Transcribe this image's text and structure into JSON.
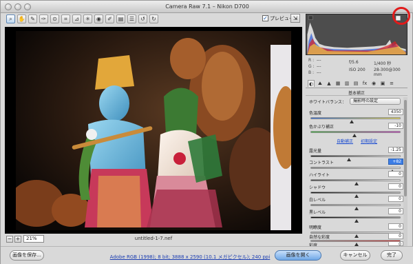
{
  "window": {
    "title": "Camera Raw 7.1  –  Nikon D700"
  },
  "toolbar": {
    "tools": [
      {
        "icon": "zoom-icon",
        "glyph": "⌕"
      },
      {
        "icon": "hand-icon",
        "glyph": "✋"
      },
      {
        "icon": "white-balance-icon",
        "glyph": "✎"
      },
      {
        "icon": "color-sampler-icon",
        "glyph": "✑"
      },
      {
        "icon": "target-adjust-icon",
        "glyph": "⊙"
      },
      {
        "icon": "crop-icon",
        "glyph": "⌗"
      },
      {
        "icon": "straighten-icon",
        "glyph": "⊿"
      },
      {
        "icon": "spot-removal-icon",
        "glyph": "✳"
      },
      {
        "icon": "red-eye-icon",
        "glyph": "◉"
      },
      {
        "icon": "adjustment-brush-icon",
        "glyph": "✐"
      },
      {
        "icon": "graduated-filter-icon",
        "glyph": "▤"
      },
      {
        "icon": "preferences-icon",
        "glyph": "☰"
      },
      {
        "icon": "rotate-ccw-icon",
        "glyph": "↺"
      },
      {
        "icon": "rotate-cw-icon",
        "glyph": "↻"
      }
    ],
    "preview_label": "プレビュー",
    "preview_checked": "✓",
    "fullscreen_glyph": "⇲"
  },
  "status": {
    "zoom_out": "−",
    "zoom_in": "+",
    "zoom": "21%",
    "filename": "untitled-1-7.nef"
  },
  "info": {
    "r": "R :",
    "g": "G :",
    "b": "B :",
    "r_val": "---",
    "g_val": "---",
    "b_val": "---",
    "aperture": "f/5.6",
    "shutter": "1/400 秒",
    "iso": "ISO 200",
    "lens": "28-300@300 mm"
  },
  "panel": {
    "tabs": [
      "◐",
      "⛰",
      "▲",
      "▦",
      "▥",
      "▤",
      "fx",
      "◉",
      "▣",
      "≡"
    ],
    "title": "基本補正",
    "wb_label": "ホワイトバランス：",
    "wb_value": "撮影時の設定",
    "temp_label": "色温度",
    "temp_value": "4350",
    "tint_label": "色かぶり補正",
    "tint_value": "-10",
    "auto_link": "自動補正",
    "default_link": "初期設定",
    "exposure_label": "露光量",
    "exposure_value": "-1.25",
    "contrast_label": "コントラスト",
    "contrast_value": "+82",
    "highlights_label": "ハイライト",
    "highlights_value": "0",
    "shadows_label": "シャドウ",
    "shadows_value": "0",
    "whites_label": "白レベル",
    "whites_value": "0",
    "blacks_label": "黒レベル",
    "blacks_value": "0",
    "clarity_label": "明瞭度",
    "clarity_value": "0",
    "vibrance_label": "自然な彩度",
    "vibrance_value": "0",
    "saturation_label": "彩度",
    "saturation_value": "0",
    "levels": {
      "temp": 0.45,
      "tint": 0.48,
      "exposure": 0.42,
      "contrast": 0.9,
      "highlights": 0.5,
      "shadows": 0.5,
      "whites": 0.5,
      "blacks": 0.5,
      "clarity": 0.5,
      "vibrance": 0.5,
      "saturation": 0.5
    }
  },
  "bottom": {
    "save": "画像を保存...",
    "workflow": "Adobe RGB (1998); 8 bit; 3888 x 2590 (10.1 メガピクセル); 240 ppi",
    "open": "画像を開く",
    "cancel": "キャンセル",
    "done": "完了"
  },
  "colors": {
    "accent": "#3d7ee6",
    "highlight_ring": "#e11a1a",
    "link": "#1b3db1"
  }
}
